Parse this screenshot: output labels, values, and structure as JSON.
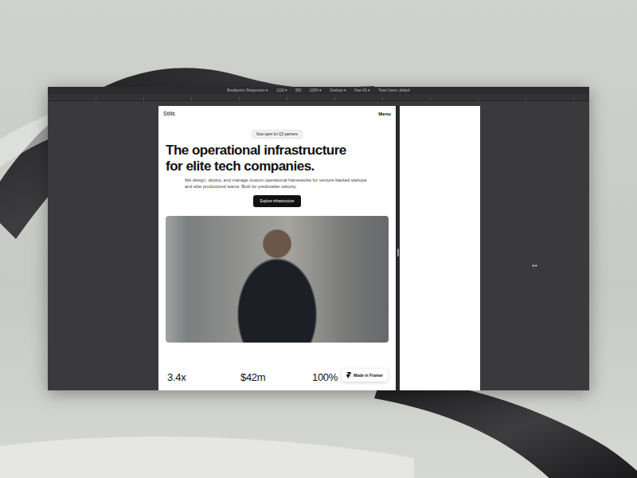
{
  "toolbar": {
    "items": [
      "Breakpoint: Responsive ▾",
      "1100 ▾",
      "850",
      "100% ▾",
      "Desktop ▾",
      "Fast 4G ▾",
      "Town Users: default"
    ]
  },
  "site": {
    "logo": "Stills",
    "menu": "Menu",
    "badge": "Now open for Q3 partners",
    "heading": [
      "The operational infrastructure",
      "for elite tech companies."
    ],
    "paragraph": "We design, deploy, and manage custom operational frameworks for venture-backed startups and elite productized teams. Built for predictable velocity.",
    "button": "Explore infrastructure",
    "stats": [
      "3.4x",
      "$42m",
      "100%"
    ]
  },
  "framer_badge": "Made in Framer",
  "resize_hint": "↔"
}
